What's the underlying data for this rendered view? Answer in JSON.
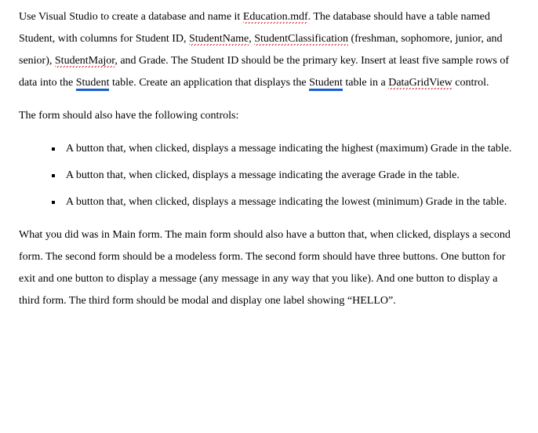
{
  "p1": {
    "t1": "Use Visual Studio to create a database and name it ",
    "w1": "Education.mdf",
    "t2": ". The database should have a table named Student, with columns for Student ID, ",
    "w2": "StudentName",
    "t3": ", ",
    "w3": "StudentClassification",
    "t4": " (freshman, sophomore, junior, and senior), ",
    "w4": "StudentMajor",
    "t5": ", and Grade. The Student ID should be the primary key. Insert at least five sample rows of data into the ",
    "w5": "Student",
    "t6": " table. Create an application that displays the ",
    "w6": "Student",
    "t7": " table in a ",
    "w7": "DataGridView",
    "t8": " control."
  },
  "p2": "The form should also have the following controls:",
  "bullets": [
    "A button that, when clicked, displays a message indicating the highest (maximum) Grade in the table.",
    "A button that, when clicked, displays a message indicating the average Grade in the table.",
    "A button that, when clicked, displays a message indicating the lowest (minimum) Grade in the table."
  ],
  "p3": "What you did was in Main form. The main form should also have a button that, when clicked, displays a second form. The second form should be a modeless form. The second form should have three buttons. One button for exit and one button to display a message (any message in any way that you like). And one button to display a third form. The third form should be modal and display one label showing “HELLO”."
}
